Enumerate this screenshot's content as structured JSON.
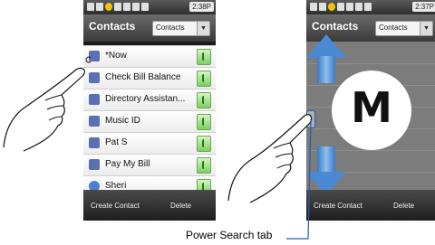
{
  "left_screen": {
    "status_time": "2:38P",
    "header": {
      "title": "Contacts",
      "dropdown_label": "Contacts"
    },
    "contacts": [
      {
        "name": "*Now"
      },
      {
        "name": "Check Bill Balance"
      },
      {
        "name": "Directory Assistan..."
      },
      {
        "name": "Music ID"
      },
      {
        "name": "Pat S"
      },
      {
        "name": "Pay My Bill"
      },
      {
        "name": "Sheri"
      }
    ],
    "bottom_bar": {
      "create_label": "Create Contact",
      "delete_label": "Delete"
    }
  },
  "right_screen": {
    "status_time": "2:37P",
    "header": {
      "title": "Contacts",
      "dropdown_label": "Contacts"
    },
    "index_letter": "M",
    "bottom_bar": {
      "create_label": "Create Contact",
      "delete_label": "Delete"
    }
  },
  "callout": {
    "label": "Power Search tab"
  },
  "colors": {
    "arrow": "#4a8ad4",
    "call_button": "#7ccf60",
    "header": "#3a3a3a"
  },
  "icons": [
    "contact-icon",
    "call-icon",
    "dropdown-arrow-icon",
    "up-arrow-icon",
    "down-arrow-icon",
    "hand-pointer-icon"
  ]
}
